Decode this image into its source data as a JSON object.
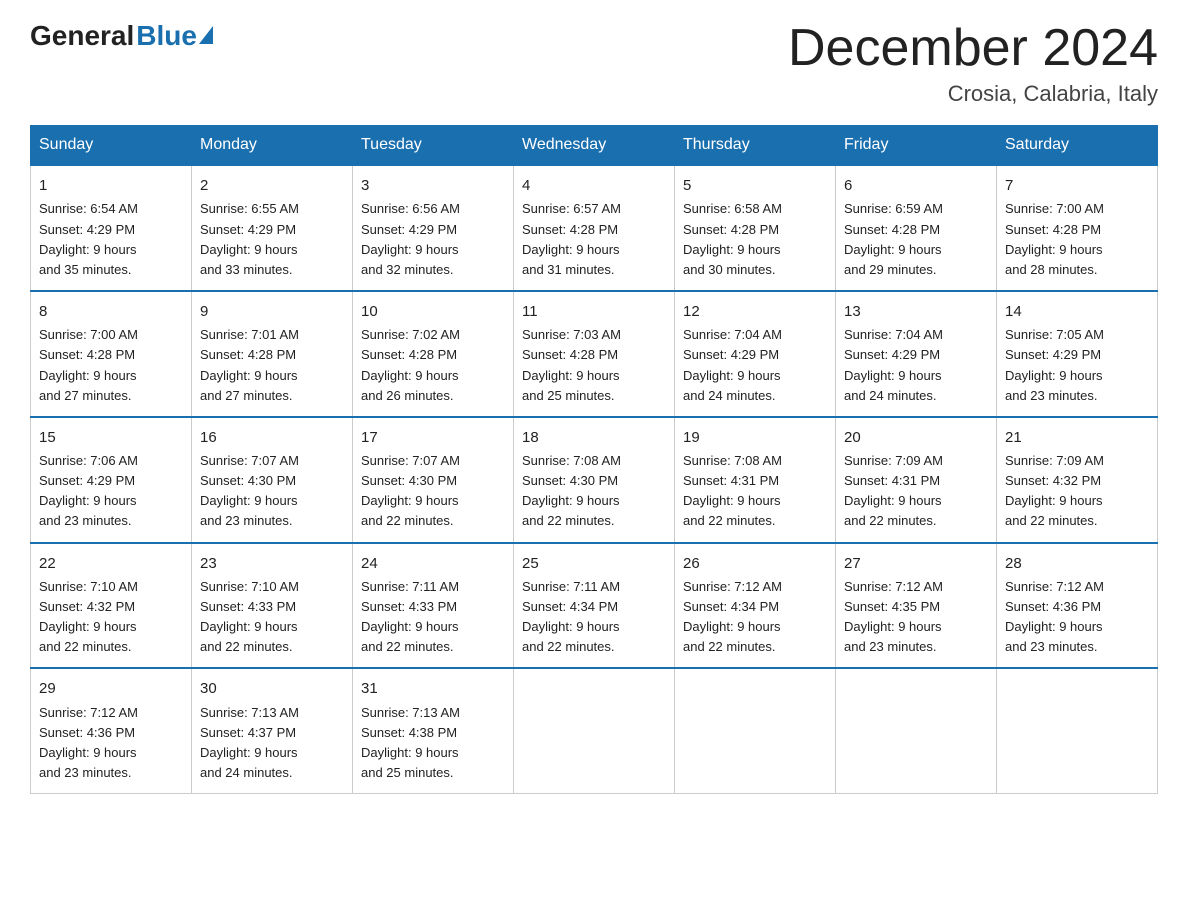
{
  "header": {
    "logo_general": "General",
    "logo_blue": "Blue",
    "month_title": "December 2024",
    "location": "Crosia, Calabria, Italy"
  },
  "days_of_week": [
    "Sunday",
    "Monday",
    "Tuesday",
    "Wednesday",
    "Thursday",
    "Friday",
    "Saturday"
  ],
  "weeks": [
    [
      {
        "day": "1",
        "sunrise": "6:54 AM",
        "sunset": "4:29 PM",
        "daylight": "9 hours and 35 minutes."
      },
      {
        "day": "2",
        "sunrise": "6:55 AM",
        "sunset": "4:29 PM",
        "daylight": "9 hours and 33 minutes."
      },
      {
        "day": "3",
        "sunrise": "6:56 AM",
        "sunset": "4:29 PM",
        "daylight": "9 hours and 32 minutes."
      },
      {
        "day": "4",
        "sunrise": "6:57 AM",
        "sunset": "4:28 PM",
        "daylight": "9 hours and 31 minutes."
      },
      {
        "day": "5",
        "sunrise": "6:58 AM",
        "sunset": "4:28 PM",
        "daylight": "9 hours and 30 minutes."
      },
      {
        "day": "6",
        "sunrise": "6:59 AM",
        "sunset": "4:28 PM",
        "daylight": "9 hours and 29 minutes."
      },
      {
        "day": "7",
        "sunrise": "7:00 AM",
        "sunset": "4:28 PM",
        "daylight": "9 hours and 28 minutes."
      }
    ],
    [
      {
        "day": "8",
        "sunrise": "7:00 AM",
        "sunset": "4:28 PM",
        "daylight": "9 hours and 27 minutes."
      },
      {
        "day": "9",
        "sunrise": "7:01 AM",
        "sunset": "4:28 PM",
        "daylight": "9 hours and 27 minutes."
      },
      {
        "day": "10",
        "sunrise": "7:02 AM",
        "sunset": "4:28 PM",
        "daylight": "9 hours and 26 minutes."
      },
      {
        "day": "11",
        "sunrise": "7:03 AM",
        "sunset": "4:28 PM",
        "daylight": "9 hours and 25 minutes."
      },
      {
        "day": "12",
        "sunrise": "7:04 AM",
        "sunset": "4:29 PM",
        "daylight": "9 hours and 24 minutes."
      },
      {
        "day": "13",
        "sunrise": "7:04 AM",
        "sunset": "4:29 PM",
        "daylight": "9 hours and 24 minutes."
      },
      {
        "day": "14",
        "sunrise": "7:05 AM",
        "sunset": "4:29 PM",
        "daylight": "9 hours and 23 minutes."
      }
    ],
    [
      {
        "day": "15",
        "sunrise": "7:06 AM",
        "sunset": "4:29 PM",
        "daylight": "9 hours and 23 minutes."
      },
      {
        "day": "16",
        "sunrise": "7:07 AM",
        "sunset": "4:30 PM",
        "daylight": "9 hours and 23 minutes."
      },
      {
        "day": "17",
        "sunrise": "7:07 AM",
        "sunset": "4:30 PM",
        "daylight": "9 hours and 22 minutes."
      },
      {
        "day": "18",
        "sunrise": "7:08 AM",
        "sunset": "4:30 PM",
        "daylight": "9 hours and 22 minutes."
      },
      {
        "day": "19",
        "sunrise": "7:08 AM",
        "sunset": "4:31 PM",
        "daylight": "9 hours and 22 minutes."
      },
      {
        "day": "20",
        "sunrise": "7:09 AM",
        "sunset": "4:31 PM",
        "daylight": "9 hours and 22 minutes."
      },
      {
        "day": "21",
        "sunrise": "7:09 AM",
        "sunset": "4:32 PM",
        "daylight": "9 hours and 22 minutes."
      }
    ],
    [
      {
        "day": "22",
        "sunrise": "7:10 AM",
        "sunset": "4:32 PM",
        "daylight": "9 hours and 22 minutes."
      },
      {
        "day": "23",
        "sunrise": "7:10 AM",
        "sunset": "4:33 PM",
        "daylight": "9 hours and 22 minutes."
      },
      {
        "day": "24",
        "sunrise": "7:11 AM",
        "sunset": "4:33 PM",
        "daylight": "9 hours and 22 minutes."
      },
      {
        "day": "25",
        "sunrise": "7:11 AM",
        "sunset": "4:34 PM",
        "daylight": "9 hours and 22 minutes."
      },
      {
        "day": "26",
        "sunrise": "7:12 AM",
        "sunset": "4:34 PM",
        "daylight": "9 hours and 22 minutes."
      },
      {
        "day": "27",
        "sunrise": "7:12 AM",
        "sunset": "4:35 PM",
        "daylight": "9 hours and 23 minutes."
      },
      {
        "day": "28",
        "sunrise": "7:12 AM",
        "sunset": "4:36 PM",
        "daylight": "9 hours and 23 minutes."
      }
    ],
    [
      {
        "day": "29",
        "sunrise": "7:12 AM",
        "sunset": "4:36 PM",
        "daylight": "9 hours and 23 minutes."
      },
      {
        "day": "30",
        "sunrise": "7:13 AM",
        "sunset": "4:37 PM",
        "daylight": "9 hours and 24 minutes."
      },
      {
        "day": "31",
        "sunrise": "7:13 AM",
        "sunset": "4:38 PM",
        "daylight": "9 hours and 25 minutes."
      },
      null,
      null,
      null,
      null
    ]
  ]
}
